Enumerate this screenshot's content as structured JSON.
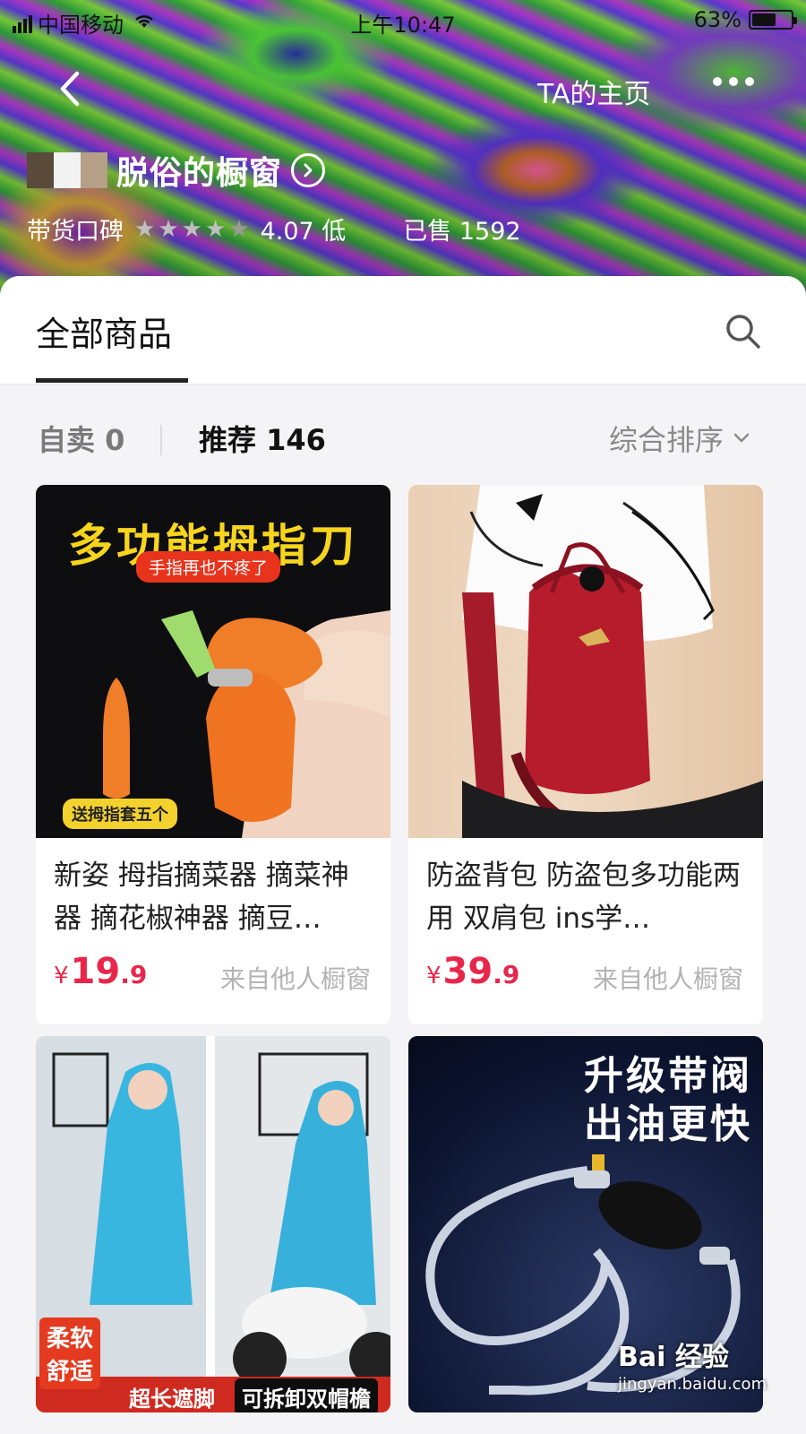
{
  "status_bar": {
    "carrier": "中国移动",
    "time": "上午10:47",
    "battery_text": "63%",
    "battery_level": 0.63
  },
  "nav": {
    "home_link": "TA的主页"
  },
  "shop": {
    "name": "脱俗的橱窗",
    "rating_label": "带货口碑",
    "rating_value": "4.07 低",
    "stars": 4.07,
    "sold": "已售 1592"
  },
  "tabs": {
    "all_products": "全部商品"
  },
  "filter": {
    "self_sell": "自卖 0",
    "recommended": "推荐 146",
    "sort": "综合排序"
  },
  "products": [
    {
      "title": "新姿 拇指摘菜器 摘菜神器 摘花椒神器 摘豆…",
      "currency": "¥",
      "price_int": "19",
      "price_dec": ".9",
      "source": "来自他人橱窗",
      "image": {
        "headline": "多功能拇指刀",
        "sub": "手指再也不疼了",
        "foot": "送拇指套五个"
      }
    },
    {
      "title": "防盗背包 防盗包多功能两用 双肩包 ins学…",
      "currency": "¥",
      "price_int": "39",
      "price_dec": ".9",
      "source": "来自他人橱窗",
      "image": {}
    },
    {
      "title": "",
      "image": {
        "tag1": "柔软",
        "tag2": "舒适",
        "tag3": "超长遮脚",
        "tag4": "可拆卸双帽檐"
      }
    },
    {
      "title": "",
      "image": {
        "headline1": "升级带阀",
        "headline2": "出油更快"
      }
    }
  ],
  "watermark": {
    "text": "Bai 经验",
    "url": "jingyan.baidu.com"
  },
  "colors": {
    "price": "#e8264b",
    "accent_yellow": "#f7d51d"
  },
  "icons": [
    "back-arrow-icon",
    "more-dots-icon",
    "circle-arrow-icon",
    "search-icon",
    "chevron-down-icon",
    "star-icon"
  ]
}
